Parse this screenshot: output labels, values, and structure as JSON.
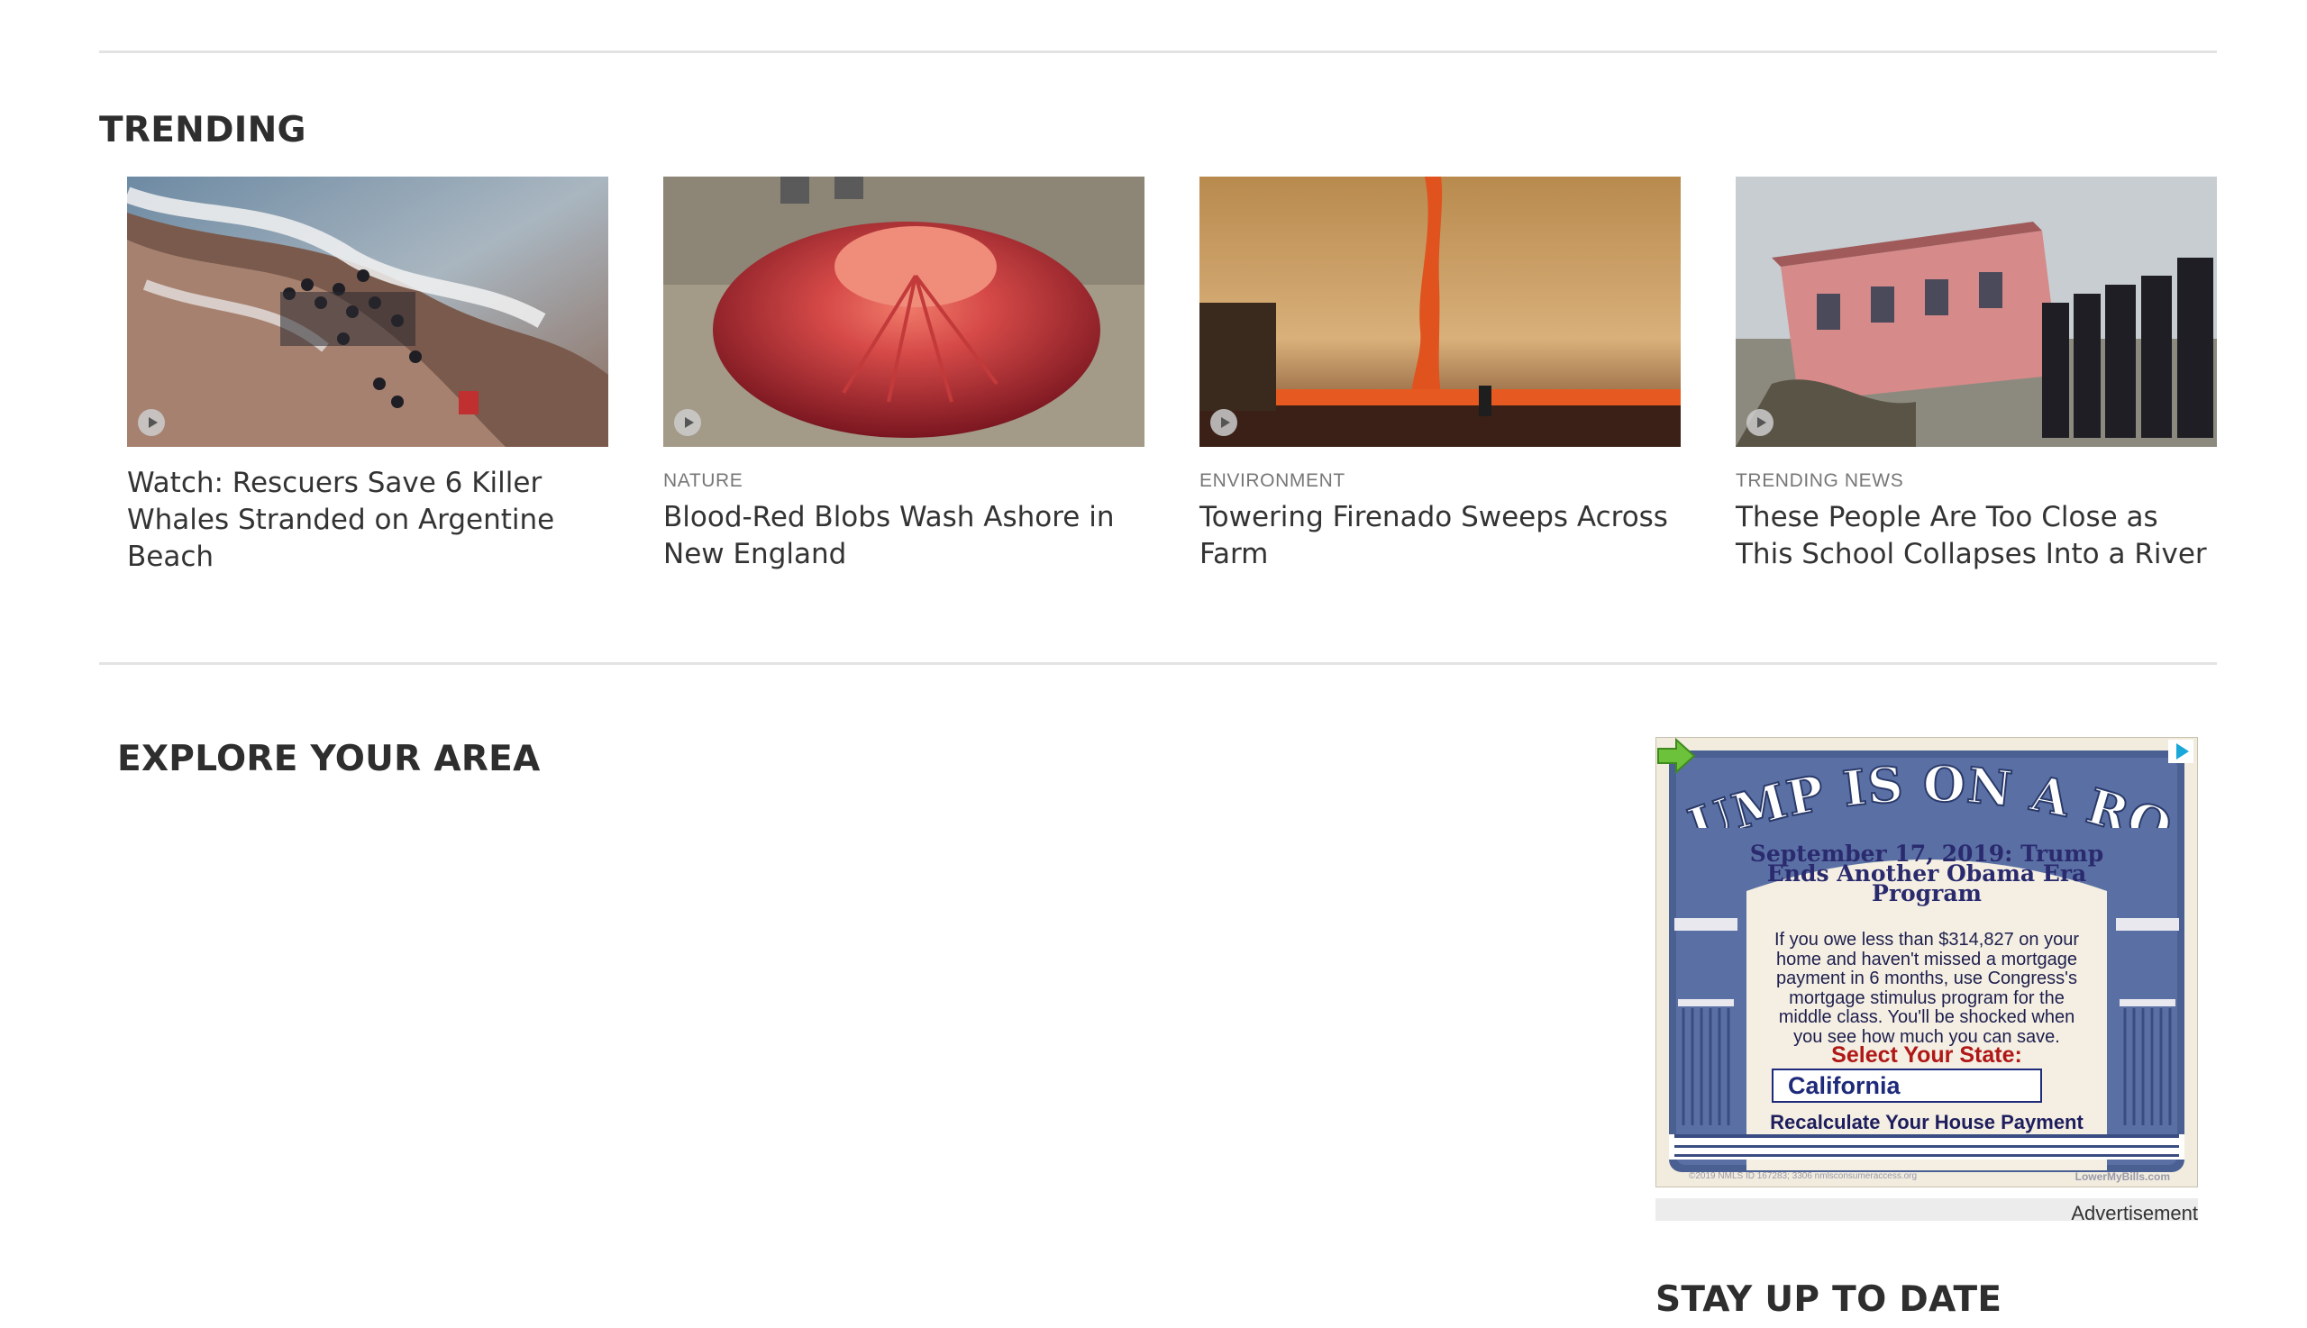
{
  "trending": {
    "title": "TRENDING",
    "cards": [
      {
        "category": "",
        "headline": "Watch: Rescuers Save 6 Killer Whales Stranded on Argentine Beach",
        "image": "beach-rescue-photo",
        "icon": "play-icon"
      },
      {
        "category": "NATURE",
        "headline": "Blood-Red Blobs Wash Ashore in New England",
        "image": "red-jellyfish-photo",
        "icon": "play-icon"
      },
      {
        "category": "ENVIRONMENT",
        "headline": "Towering Firenado Sweeps Across Farm",
        "image": "fire-tornado-photo",
        "icon": "play-icon"
      },
      {
        "category": "TRENDING NEWS",
        "headline": "These People Are Too Close as This School Collapses Into a River",
        "image": "collapsing-school-photo",
        "icon": "play-icon"
      }
    ]
  },
  "explore": {
    "title": "EXPLORE YOUR AREA"
  },
  "ad": {
    "banner": "TRUMP IS ON A ROLL",
    "headline_line1": "September 17, 2019: Trump",
    "headline_line2": "Ends Another Obama Era",
    "headline_line3": "Program",
    "body_line1": "If you owe less than $314,827 on your",
    "body_line2": "home and haven't missed a mortgage",
    "body_line3": "payment in 6 months, use Congress's",
    "body_line4": "mortgage stimulus program for the",
    "body_line5": "middle class. You'll be shocked when",
    "body_line6": "you see how much you can save.",
    "select_label": "Select Your State:",
    "state_value": "California",
    "cta": "Recalculate Your House Payment",
    "legal": "©2019 NMLS ID 167283; 3306 nmlsconsumeraccess.org",
    "brand": "LowerMyBills.com",
    "choices_icon": "adchoices-icon",
    "label": "Advertisement"
  },
  "stay": {
    "title": "STAY UP TO DATE"
  },
  "colors": {
    "rule": "#e3e3e3",
    "heading": "#2e2e2e",
    "category": "#777777",
    "ad_red": "#b01717",
    "ad_navy": "#1e2a7a"
  }
}
